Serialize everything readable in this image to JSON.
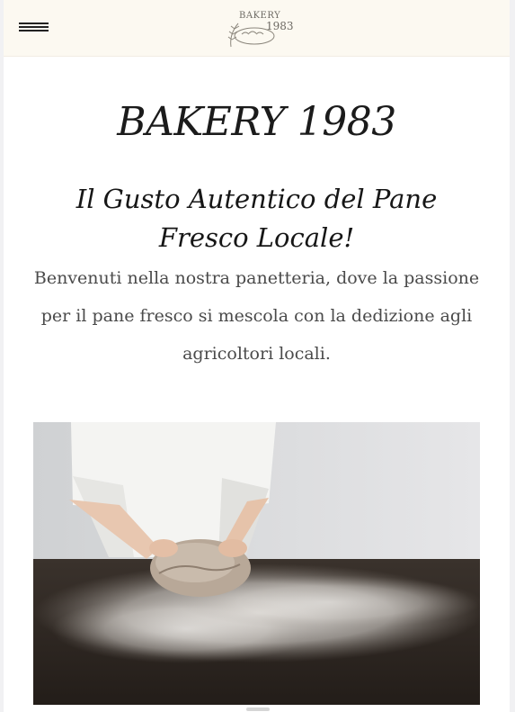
{
  "header": {
    "menu_icon": "hamburger-icon",
    "logo": {
      "line1": "BAKERY",
      "line2": "1983",
      "icon": "bread-icon"
    }
  },
  "main": {
    "title": "BAKERY 1983",
    "subtitle": "Il Gusto Autentico del Pane Fresco Locale!",
    "intro": "Benvenuti nella nostra panetteria, dove la passione per il pane fresco si mescola con la dedizione agli agricoltori locali."
  },
  "colors": {
    "header_bg": "#fcf9f1",
    "page_bg": "#ffffff",
    "text": "#1b1b1b"
  }
}
